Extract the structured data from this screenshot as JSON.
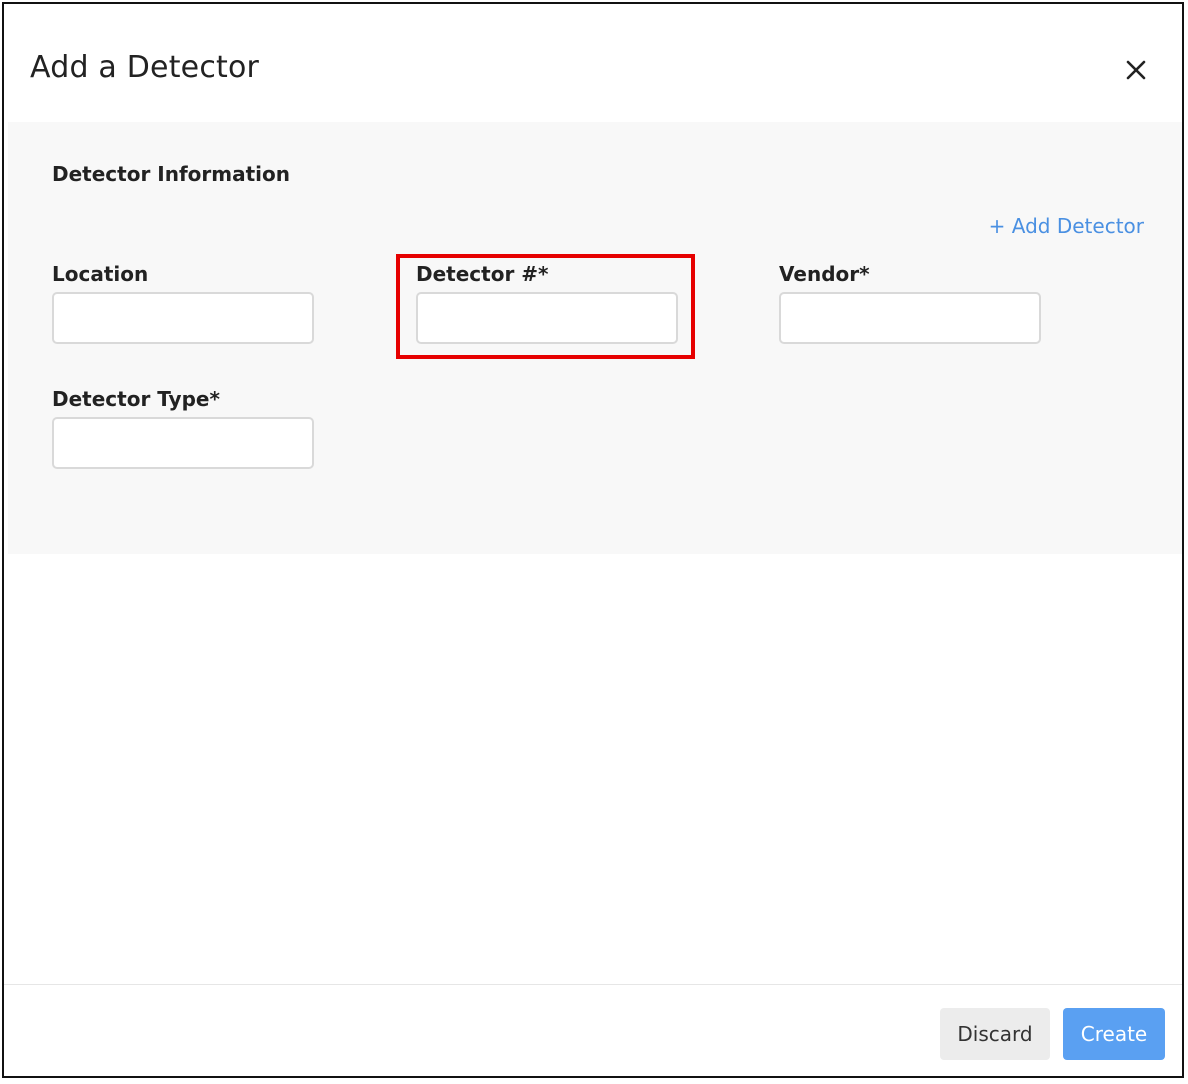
{
  "dialog": {
    "title": "Add a Detector",
    "close_icon": "close-icon"
  },
  "form": {
    "section_title": "Detector Information",
    "add_detector_link": "+ Add Detector",
    "fields": {
      "location": {
        "label": "Location",
        "value": ""
      },
      "detector_number": {
        "label": "Detector #*",
        "value": ""
      },
      "vendor": {
        "label": "Vendor*",
        "value": ""
      },
      "detector_type": {
        "label": "Detector Type*",
        "value": ""
      }
    }
  },
  "footer": {
    "discard_label": "Discard",
    "create_label": "Create"
  },
  "colors": {
    "accent": "#4a90e2",
    "primary_button": "#5aa0f2",
    "highlight": "#e60000",
    "panel_bg": "#f8f8f8"
  }
}
